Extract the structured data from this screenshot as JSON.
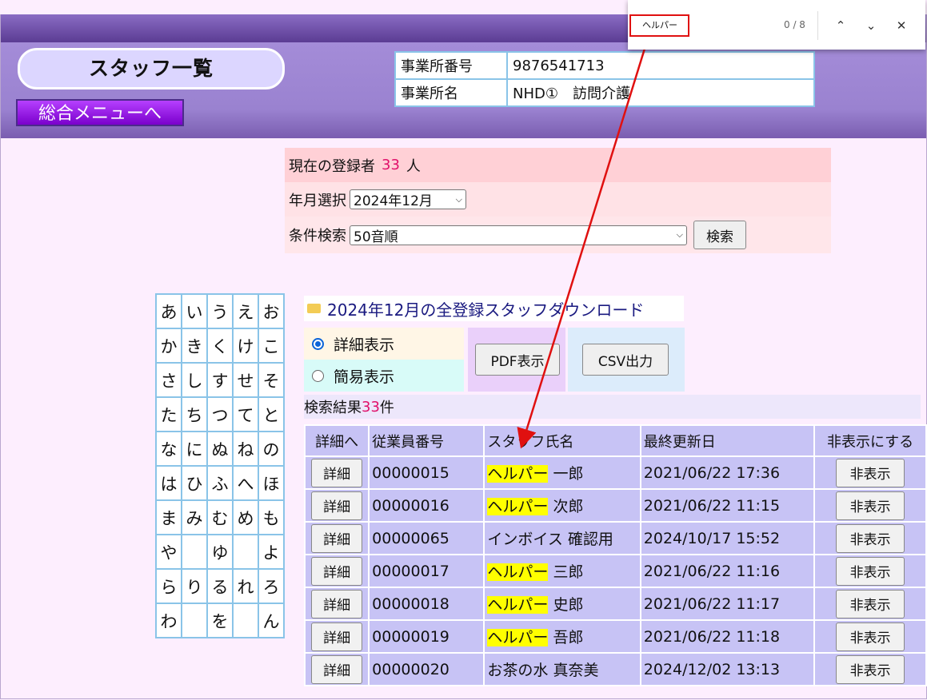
{
  "page": {
    "title": "スタッフ一覧",
    "menu_button": "総合メニューへ"
  },
  "office": {
    "number_label": "事業所番号",
    "number_value": "9876541713",
    "name_label": "事業所名",
    "name_value": "NHD①　訪問介護"
  },
  "conditions": {
    "registered_prefix": "現在の登録者",
    "registered_count": "33",
    "registered_suffix": "人",
    "month_label": "年月選択",
    "month_value": "2024年12月",
    "search_label": "条件検索",
    "search_value": "50音順",
    "search_button": "検索"
  },
  "kana": [
    [
      "あ",
      "い",
      "う",
      "え",
      "お"
    ],
    [
      "か",
      "き",
      "く",
      "け",
      "こ"
    ],
    [
      "さ",
      "し",
      "す",
      "せ",
      "そ"
    ],
    [
      "た",
      "ち",
      "つ",
      "て",
      "と"
    ],
    [
      "な",
      "に",
      "ぬ",
      "ね",
      "の"
    ],
    [
      "は",
      "ひ",
      "ふ",
      "へ",
      "ほ"
    ],
    [
      "ま",
      "み",
      "む",
      "め",
      "も"
    ],
    [
      "や",
      "",
      "ゆ",
      "",
      "よ"
    ],
    [
      "ら",
      "り",
      "る",
      "れ",
      "ろ"
    ],
    [
      "わ",
      "",
      "を",
      "",
      "ん"
    ]
  ],
  "download": {
    "link": "2024年12月の全登録スタッフダウンロード"
  },
  "display_mode": {
    "detail": "詳細表示",
    "simple": "簡易表示",
    "selected": "detail"
  },
  "export": {
    "pdf": "PDF表示",
    "csv": "CSV出力"
  },
  "results": {
    "prefix": "検索結果",
    "count": "33",
    "suffix": "件"
  },
  "table": {
    "headers": [
      "詳細へ",
      "従業員番号",
      "スタッフ氏名",
      "最終更新日",
      "非表示にする"
    ],
    "detail_button": "詳細",
    "hide_button": "非表示",
    "rows": [
      {
        "id": "00000015",
        "name_hl": "ヘルパー",
        "name_rest": " 一郎",
        "updated": "2021/06/22 17:36"
      },
      {
        "id": "00000016",
        "name_hl": "ヘルパー",
        "name_rest": " 次郎",
        "updated": "2021/06/22 11:15"
      },
      {
        "id": "00000065",
        "name_hl": "",
        "name_rest": "インボイス 確認用",
        "updated": "2024/10/17 15:52"
      },
      {
        "id": "00000017",
        "name_hl": "ヘルパー",
        "name_rest": " 三郎",
        "updated": "2021/06/22 11:16"
      },
      {
        "id": "00000018",
        "name_hl": "ヘルパー",
        "name_rest": " 史郎",
        "updated": "2021/06/22 11:17"
      },
      {
        "id": "00000019",
        "name_hl": "ヘルパー",
        "name_rest": " 吾郎",
        "updated": "2021/06/22 11:18"
      },
      {
        "id": "00000020",
        "name_hl": "",
        "name_rest": "お茶の水 真奈美",
        "updated": "2024/12/02 13:13"
      }
    ]
  },
  "find_bar": {
    "query": "ヘルパー",
    "count": "0 / 8"
  },
  "colors": {
    "highlight": "#ffff00",
    "annotation": "#e01010",
    "accent": "#e0106a"
  }
}
